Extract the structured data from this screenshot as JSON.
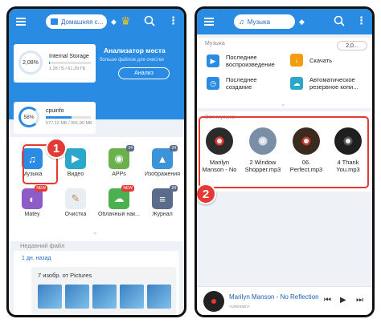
{
  "left": {
    "header": {
      "location": "Домашняя с...",
      "colors": {
        "bar": "#2a8be2"
      }
    },
    "storage": {
      "label": "Internal Storage",
      "percent": "2,08%",
      "size": "1,28 ГБ / 61,39 ГБ",
      "used_fraction": 0.021
    },
    "analyzer": {
      "title": "Анализатор места",
      "subtitle": "больше файлов для очистки",
      "button": "Анализ"
    },
    "cpu": {
      "label": "cpuinfo",
      "percent": "58%",
      "size": "577,12 МБ / 991,90 МБ",
      "used_fraction": 0.58
    },
    "categories": [
      {
        "label": "Музыка",
        "icon": "music-note-icon",
        "color": "#2a8be2",
        "badge": ""
      },
      {
        "label": "Видео",
        "icon": "play-icon",
        "color": "#2aa7c9",
        "badge": ""
      },
      {
        "label": "APPs",
        "icon": "android-icon",
        "color": "#6ab04c",
        "badge": "24"
      },
      {
        "label": "Изображения",
        "icon": "image-icon",
        "color": "#3d93d8",
        "badge": "24"
      },
      {
        "label": "Matey",
        "icon": "matey-icon",
        "color": "#8e5cc7",
        "badge": "NEW"
      },
      {
        "label": "Очистка",
        "icon": "broom-icon",
        "color": "#e9eef3",
        "badge": ""
      },
      {
        "label": "Облачный нак...",
        "icon": "cloud-icon",
        "color": "#4caf50",
        "badge": "NEW"
      },
      {
        "label": "Журнал",
        "icon": "layers-icon",
        "color": "#5a6c8a",
        "badge": "24"
      }
    ],
    "recent": {
      "label": "Недавний файл",
      "day": "1 дн. назад",
      "group_title": "7 изобр. от Pictures"
    },
    "step": "1"
  },
  "right": {
    "header": {
      "tab": "Музыка"
    },
    "panel_label": "Музыка",
    "storage_chip": "2,0...",
    "actions": [
      {
        "label": "Последнее воспроизведение",
        "icon": "play-square-icon",
        "color": "#2a8be2"
      },
      {
        "label": "Скачать",
        "icon": "download-icon",
        "color": "#f39c12"
      },
      {
        "label": "Последнее создание",
        "icon": "clock-icon",
        "color": "#2a8be2"
      },
      {
        "label": "Автоматическое резервное копи...",
        "icon": "cloud-backup-icon",
        "color": "#2aa7c9"
      }
    ],
    "all_music_label": "Вся музыка",
    "songs": [
      {
        "name": "Marilyn Manson - No",
        "cover": "#2b2b2b",
        "accent": "#e53935"
      },
      {
        "name": "2 Window Shopper.mp3",
        "cover": "#7a8fa6",
        "accent": "#cfd8e3"
      },
      {
        "name": "06. Perfect.mp3",
        "cover": "#3b2a1e",
        "accent": "#c0392b"
      },
      {
        "name": "4 Thank You.mp3",
        "cover": "#1f1f1f",
        "accent": "#555555"
      }
    ],
    "player": {
      "title": "Marilyn Manson - No Reflection",
      "subtitle": "<unknown>"
    },
    "step": "2"
  }
}
